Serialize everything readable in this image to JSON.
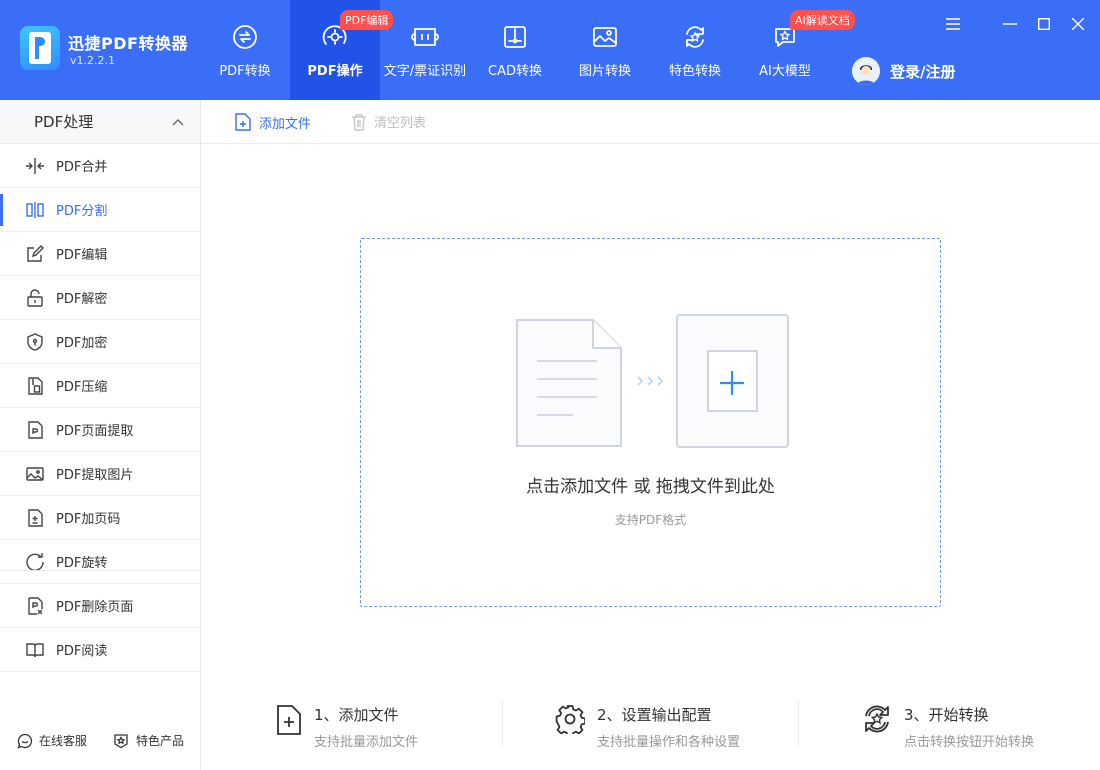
{
  "app": {
    "name": "迅捷PDF转换器",
    "version": "v1.2.2.1"
  },
  "nav": [
    {
      "label": "PDF转换",
      "icon": "pdf-convert-icon"
    },
    {
      "label": "PDF操作",
      "icon": "pdf-operate-icon",
      "active": true,
      "badge": "PDF编辑"
    },
    {
      "label": "文字/票证识别",
      "icon": "ocr-icon"
    },
    {
      "label": "CAD转换",
      "icon": "cad-icon"
    },
    {
      "label": "图片转换",
      "icon": "image-icon"
    },
    {
      "label": "特色转换",
      "icon": "feature-icon"
    },
    {
      "label": "AI大模型",
      "icon": "ai-icon",
      "badge": "AI解读文档"
    }
  ],
  "login": {
    "label": "登录/注册"
  },
  "sidebar": {
    "section_title": "PDF处理",
    "items": [
      {
        "label": "PDF合并",
        "icon": "merge-icon"
      },
      {
        "label": "PDF分割",
        "icon": "split-icon",
        "active": true
      },
      {
        "label": "PDF编辑",
        "icon": "edit-icon"
      },
      {
        "label": "PDF解密",
        "icon": "unlock-icon"
      },
      {
        "label": "PDF加密",
        "icon": "shield-icon"
      },
      {
        "label": "PDF压缩",
        "icon": "compress-icon"
      },
      {
        "label": "PDF页面提取",
        "icon": "page-extract-icon"
      },
      {
        "label": "PDF提取图片",
        "icon": "extract-image-icon"
      },
      {
        "label": "PDF加页码",
        "icon": "page-number-icon"
      },
      {
        "label": "PDF旋转",
        "icon": "rotate-icon"
      },
      {
        "label": "PDF删除页面",
        "icon": "delete-page-icon"
      },
      {
        "label": "PDF阅读",
        "icon": "book-icon"
      }
    ],
    "footer": {
      "service": "在线客服",
      "products": "特色产品"
    }
  },
  "toolbar": {
    "add_file": "添加文件",
    "clear_list": "清空列表"
  },
  "dropzone": {
    "main_text": "点击添加文件 或 拖拽文件到此处",
    "sub_text": "支持PDF格式"
  },
  "steps": [
    {
      "title": "1、添加文件",
      "desc": "支持批量添加文件"
    },
    {
      "title": "2、设置输出配置",
      "desc": "支持批量操作和各种设置"
    },
    {
      "title": "3、开始转换",
      "desc": "点击转换按钮开始转换"
    }
  ],
  "colors": {
    "brand": "#3a6ef7",
    "brand_active": "#2253e8",
    "badge": "#ff4f4f",
    "accent": "#2f8cff"
  }
}
